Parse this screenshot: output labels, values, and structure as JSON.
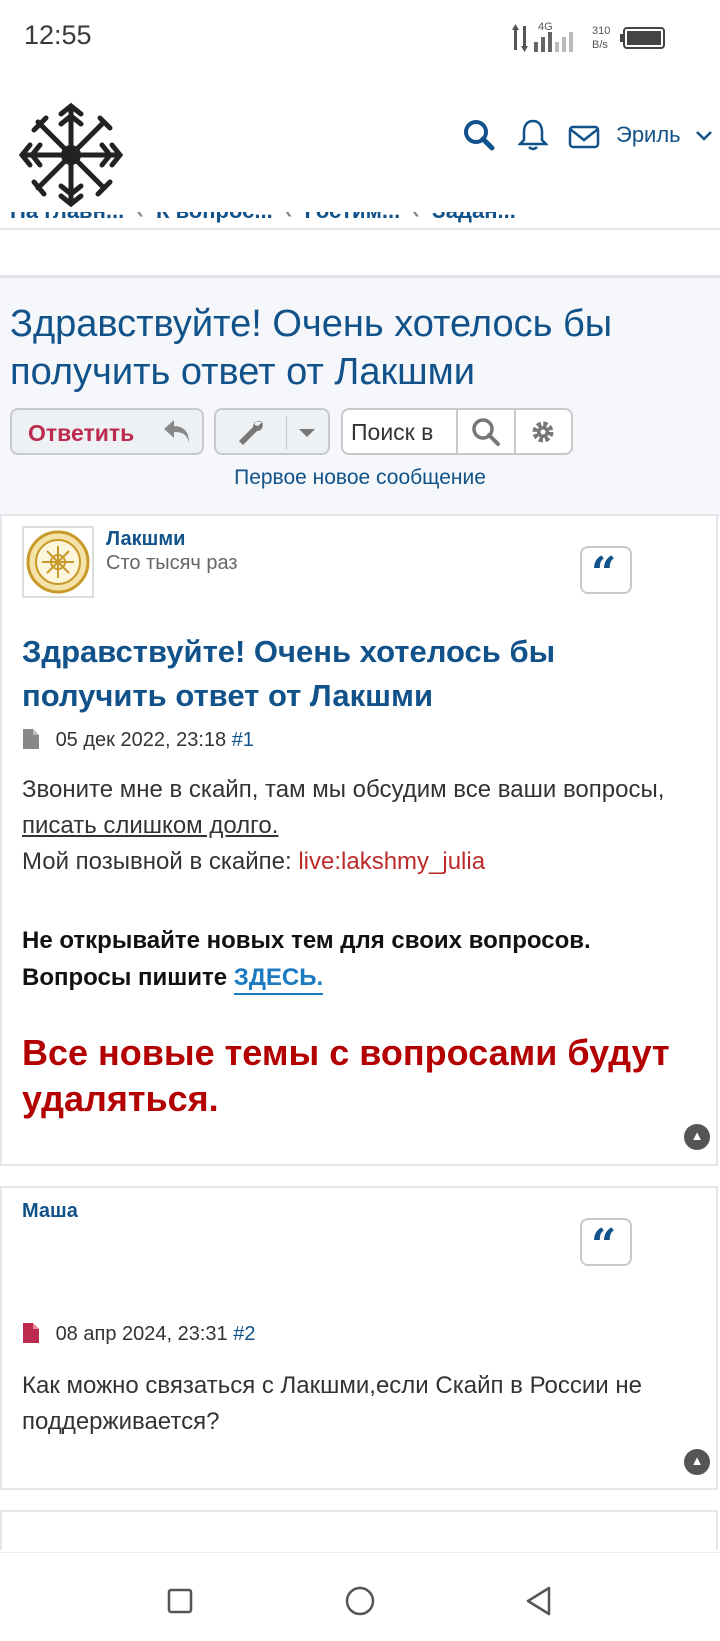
{
  "status_bar": {
    "time": "12:55",
    "network": "4G",
    "speed_value": "310",
    "speed_unit": "B/s"
  },
  "header": {
    "username": "Эриль",
    "breadcrumbs": [
      "На главн...",
      "К вопрос...",
      "Гостим...",
      "Задан..."
    ]
  },
  "topic": {
    "title": "Здравствуйте! Очень хотелось бы получить ответ от Лакшми",
    "reply_label": "Ответить",
    "search_placeholder": "Поиск в",
    "first_unread": "Первое новое сообщение"
  },
  "posts": [
    {
      "author": "Лакшми",
      "rank": "Сто тысяч раз",
      "title": "Здравствуйте! Очень хотелось бы получить ответ от Лакшми",
      "date": "05 дек 2022, 23:18",
      "number": "#1",
      "line1": "Звоните мне в скайп, там мы обсудим все ваши вопросы, ",
      "line1_link": "писать слишком долго.",
      "line2_prefix": "Мой позывной в скайпе: ",
      "skype": "live:lakshmy_julia",
      "rule1": "Не открывайте новых тем для своих вопросов.",
      "rule2_prefix": "Вопросы пишите ",
      "rule2_link": "ЗДЕСЬ.",
      "warning": "Все новые темы с вопросами будут удаляться."
    },
    {
      "author": "Маша",
      "date": "08 апр 2024, 23:31",
      "number": "#2",
      "content": "Как можно связаться с Лакшми,если Скайп в России не поддерживается?"
    }
  ],
  "colors": {
    "link": "#105289",
    "reply": "#bc2a4d",
    "warning": "#b30000"
  }
}
